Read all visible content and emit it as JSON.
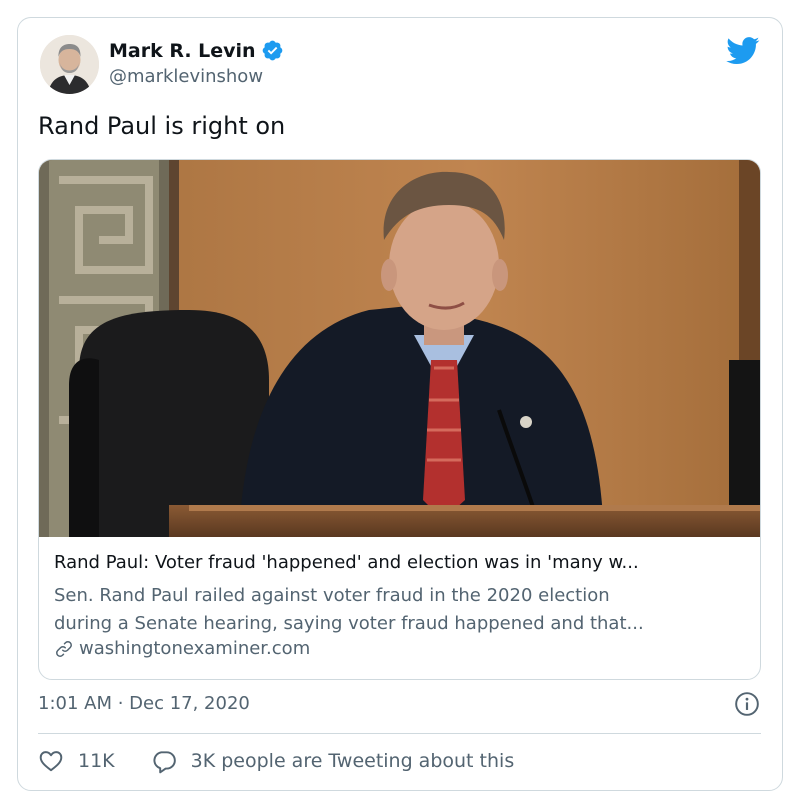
{
  "author": {
    "display_name": "Mark R. Levin",
    "handle": "@marklevinshow",
    "avatar_icon": "avatar-photo",
    "verified_icon": "verified-badge-icon"
  },
  "brand": {
    "icon": "twitter-bird-icon",
    "color": "#1d9bf0"
  },
  "tweet": {
    "text": "Rand Paul is right on"
  },
  "link_card": {
    "image_icon": "article-photo",
    "title": "Rand Paul: Voter fraud 'happened' and election was in 'many w...",
    "description_lines": [
      "Sen. Rand Paul railed against voter fraud in the 2020 election",
      "during a Senate hearing, saying voter fraud happened and that..."
    ],
    "domain": "washingtonexaminer.com",
    "domain_icon": "link-icon"
  },
  "meta": {
    "timestamp": "1:01 AM · Dec 17, 2020",
    "info_icon": "info-icon"
  },
  "actions": {
    "likes": "11K",
    "like_icon": "heart-icon",
    "reply_text": "3K people are Tweeting about this",
    "reply_icon": "reply-bubble-icon"
  },
  "colors": {
    "text_primary": "#0f1419",
    "text_secondary": "#536471",
    "border": "#cfd9de",
    "accent": "#1d9bf0"
  }
}
